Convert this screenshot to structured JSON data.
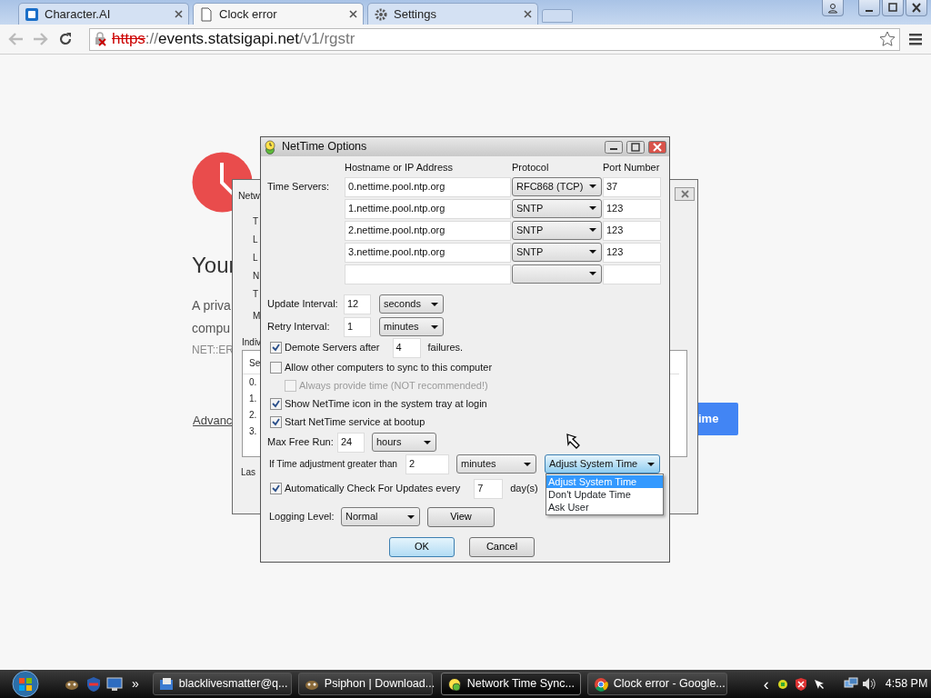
{
  "browser": {
    "tabs": [
      {
        "title": "Character.AI",
        "selected": false
      },
      {
        "title": "Clock error",
        "selected": true
      },
      {
        "title": "Settings",
        "selected": false
      }
    ],
    "url": {
      "secure": false,
      "scheme": "https",
      "separator": "://",
      "host": "events.statsigapi.net",
      "path": "/v1/rgstr"
    }
  },
  "page": {
    "heading": "Your",
    "lines": [
      "A priva",
      "compu"
    ],
    "error_code": "NET::ER",
    "advanced_link": "Advanc",
    "button": "ime"
  },
  "back_window": {
    "title": "Netw",
    "labels": [
      "T",
      "L",
      "L",
      "N",
      "T",
      "M"
    ],
    "section": "Indiv",
    "list_header": "Se",
    "list_rows": [
      "0.",
      "1.",
      "2.",
      "3."
    ],
    "footer": "Las"
  },
  "dialog": {
    "title": "NetTime Options",
    "columns": [
      "Hostname or IP Address",
      "Protocol",
      "Port Number"
    ],
    "servers_label": "Time Servers:",
    "servers": [
      {
        "host": "0.nettime.pool.ntp.org",
        "protocol": "RFC868 (TCP)",
        "port": "37"
      },
      {
        "host": "1.nettime.pool.ntp.org",
        "protocol": "SNTP",
        "port": "123"
      },
      {
        "host": "2.nettime.pool.ntp.org",
        "protocol": "SNTP",
        "port": "123"
      },
      {
        "host": "3.nettime.pool.ntp.org",
        "protocol": "SNTP",
        "port": "123"
      }
    ],
    "update_interval": {
      "label": "Update Interval:",
      "value": "12",
      "unit": "seconds"
    },
    "retry_interval": {
      "label": "Retry Interval:",
      "value": "1",
      "unit": "minutes"
    },
    "demote": {
      "label": "Demote Servers after",
      "checked": true,
      "value": "4",
      "suffix": "failures."
    },
    "allow_sync": {
      "label": "Allow other computers to sync to this computer",
      "checked": false,
      "children": [
        {
          "label": "Always provide time (NOT recommended!)",
          "checked": false,
          "disabled": true
        }
      ]
    },
    "show_tray_icon": {
      "label": "Show NetTime icon in the system tray at login",
      "checked": true
    },
    "start_service": {
      "label": "Start NetTime service at bootup",
      "checked": true
    },
    "max_free_run": {
      "label": "Max Free Run:",
      "value": "24",
      "unit": "hours"
    },
    "adjustment": {
      "label": "If Time adjustment greater than",
      "value": "2",
      "unit": "minutes",
      "action": "Adjust System Time",
      "menu": {
        "open": true,
        "options": [
          {
            "label": "Adjust System Time",
            "selected": true
          },
          {
            "label": "Don't Update Time",
            "selected": false
          },
          {
            "label": "Ask User",
            "selected": false
          }
        ]
      }
    },
    "auto_update": {
      "label": "Automatically Check For Updates every",
      "checked": true,
      "value": "7",
      "suffix": "day(s)"
    },
    "logging": {
      "label": "Logging Level:",
      "level": "Normal",
      "view_button": "View"
    },
    "buttons": [
      {
        "label": "OK",
        "default": true
      },
      {
        "label": "Cancel",
        "default": false
      }
    ]
  },
  "taskbar": {
    "more": "»",
    "tasks": [
      {
        "label": "blacklivesmatter@q...",
        "kind": "mail",
        "selected": false
      },
      {
        "label": "Psiphon | Download...",
        "kind": "psiphon",
        "selected": false
      },
      {
        "label": "Network Time Sync...",
        "kind": "clock",
        "selected": true
      },
      {
        "label": "Clock error - Google...",
        "kind": "browser",
        "selected": false
      }
    ],
    "tray_arrow": "‹",
    "clock": "4:58 PM"
  }
}
